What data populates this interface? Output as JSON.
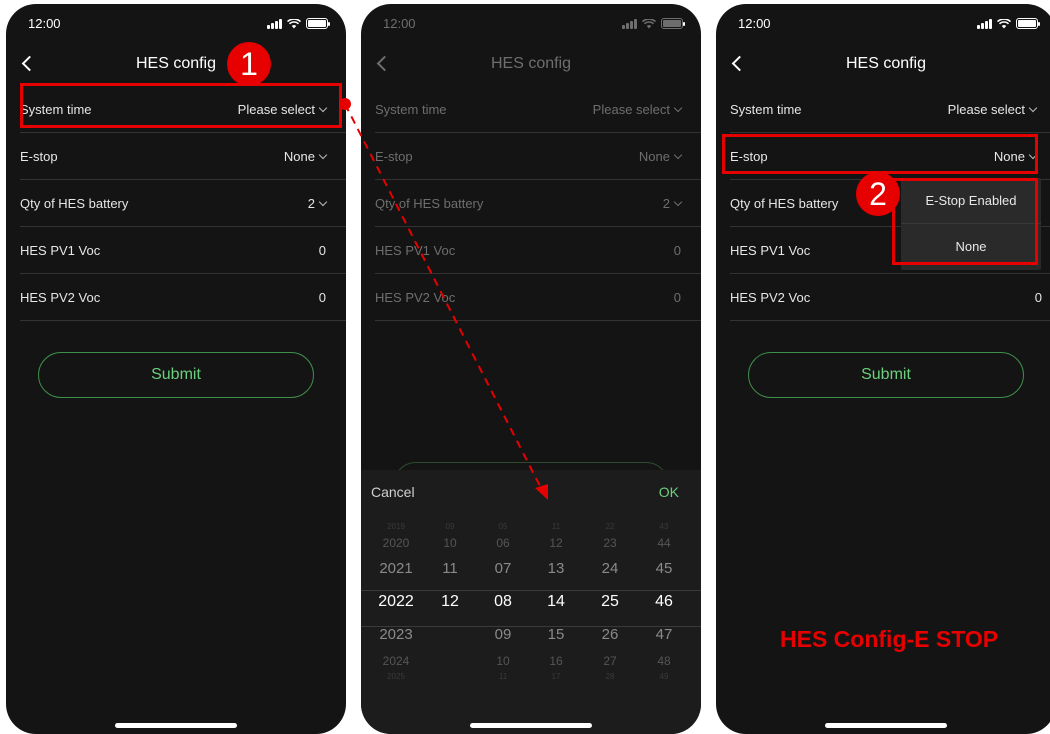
{
  "status": {
    "time": "12:00"
  },
  "header": {
    "title": "HES config"
  },
  "fields": [
    {
      "label": "System time",
      "value": "Please select",
      "dropdown": true
    },
    {
      "label": "E-stop",
      "value": "None",
      "dropdown": true
    },
    {
      "label": "Qty of HES battery",
      "value": "2",
      "dropdown": true
    },
    {
      "label": "HES PV1 Voc",
      "value": "0",
      "dropdown": false
    },
    {
      "label": "HES PV2 Voc",
      "value": "0",
      "dropdown": false
    }
  ],
  "submit_label": "Submit",
  "picker": {
    "cancel_label": "Cancel",
    "ok_label": "OK",
    "columns": [
      [
        "2019",
        "2020",
        "2021",
        "2022",
        "2023",
        "2024",
        "2025"
      ],
      [
        "09",
        "10",
        "11",
        "12",
        "",
        "",
        ""
      ],
      [
        "05",
        "06",
        "07",
        "08",
        "09",
        "10",
        "11"
      ],
      [
        "11",
        "12",
        "13",
        "14",
        "15",
        "16",
        "17"
      ],
      [
        "22",
        "23",
        "24",
        "25",
        "26",
        "27",
        "28"
      ],
      [
        "43",
        "44",
        "45",
        "46",
        "47",
        "48",
        "49"
      ]
    ]
  },
  "estop_options": [
    "E-Stop Enabled",
    "None"
  ],
  "annotations": {
    "step1": "1",
    "step2": "2",
    "caption": "HES Config-E STOP",
    "color": "#e60000"
  },
  "colors": {
    "accent": "#6ccf7d",
    "background": "#141414"
  }
}
